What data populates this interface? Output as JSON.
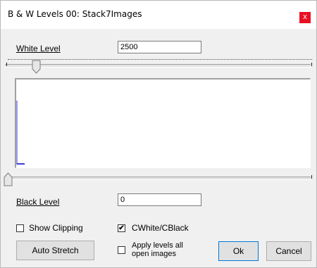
{
  "window": {
    "title": "B & W Levels 00: Stack7Images",
    "close_label": "x"
  },
  "white_level": {
    "label": "White Level",
    "value": "2500"
  },
  "black_level": {
    "label": "Black Level",
    "value": "0"
  },
  "options": {
    "show_clipping": {
      "label": "Show Clipping",
      "checked": false
    },
    "cwhite_cblack": {
      "label": "CWhite/CBlack",
      "checked": true
    },
    "apply_all": {
      "label_line1": "Apply levels all",
      "label_line2": "open images",
      "checked": false
    }
  },
  "buttons": {
    "auto_stretch": "Auto  Stretch",
    "ok": "Ok",
    "cancel": "Cancel"
  },
  "colors": {
    "histogram_trace": "#3b3bd1",
    "close_button": "#e81123",
    "default_button_border": "#0078d7"
  },
  "checkmark_glyph": "✔"
}
